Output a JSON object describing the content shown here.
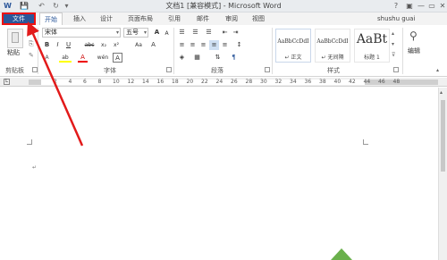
{
  "title": "文档1 [兼容模式] - Microsoft Word",
  "window": {
    "help": "?",
    "minimize": "—",
    "restore": "▭",
    "close": "✕"
  },
  "quick_access": {
    "save": "💾",
    "undo": "↶",
    "redo": "↻",
    "more": "▾"
  },
  "tabs": {
    "file": "文件",
    "home": "开始",
    "insert": "插入",
    "design": "设计",
    "layout": "页面布局",
    "references": "引用",
    "mailings": "邮件",
    "review": "审阅",
    "view": "视图"
  },
  "user": "shushu guai",
  "clipboard": {
    "paste": "粘贴",
    "group": "剪贴板"
  },
  "font": {
    "name": "宋体",
    "size": "五号",
    "group": "字体",
    "bold": "B",
    "italic": "I",
    "underline": "U",
    "strike": "abc",
    "sub": "x₂",
    "sup": "x²",
    "grow": "A",
    "shrink": "A",
    "case": "Aa",
    "clear": "A",
    "highlight": "ab",
    "color": "A",
    "wen": "wén",
    "border_a": "A"
  },
  "paragraph": {
    "group": "段落",
    "show_marks": "¶"
  },
  "styles": {
    "group": "样式",
    "items": [
      {
        "sample": "AaBbCcDdI",
        "name": "↵ 正文"
      },
      {
        "sample": "AaBbCcDdI",
        "name": "↵ 无间隔"
      },
      {
        "sample": "AaBt",
        "name": "标题 1"
      }
    ]
  },
  "editing": {
    "label": "编辑"
  },
  "ruler_numbers": [
    "2",
    "4",
    "6",
    "8",
    "10",
    "12",
    "14",
    "16",
    "18",
    "20",
    "22",
    "24",
    "26",
    "28",
    "30",
    "32",
    "34",
    "36",
    "38",
    "40",
    "42",
    "44",
    "46",
    "48"
  ],
  "colors": {
    "accent": "#2b579a",
    "highlight": "#e11",
    "arrow": "#e21a1a"
  }
}
